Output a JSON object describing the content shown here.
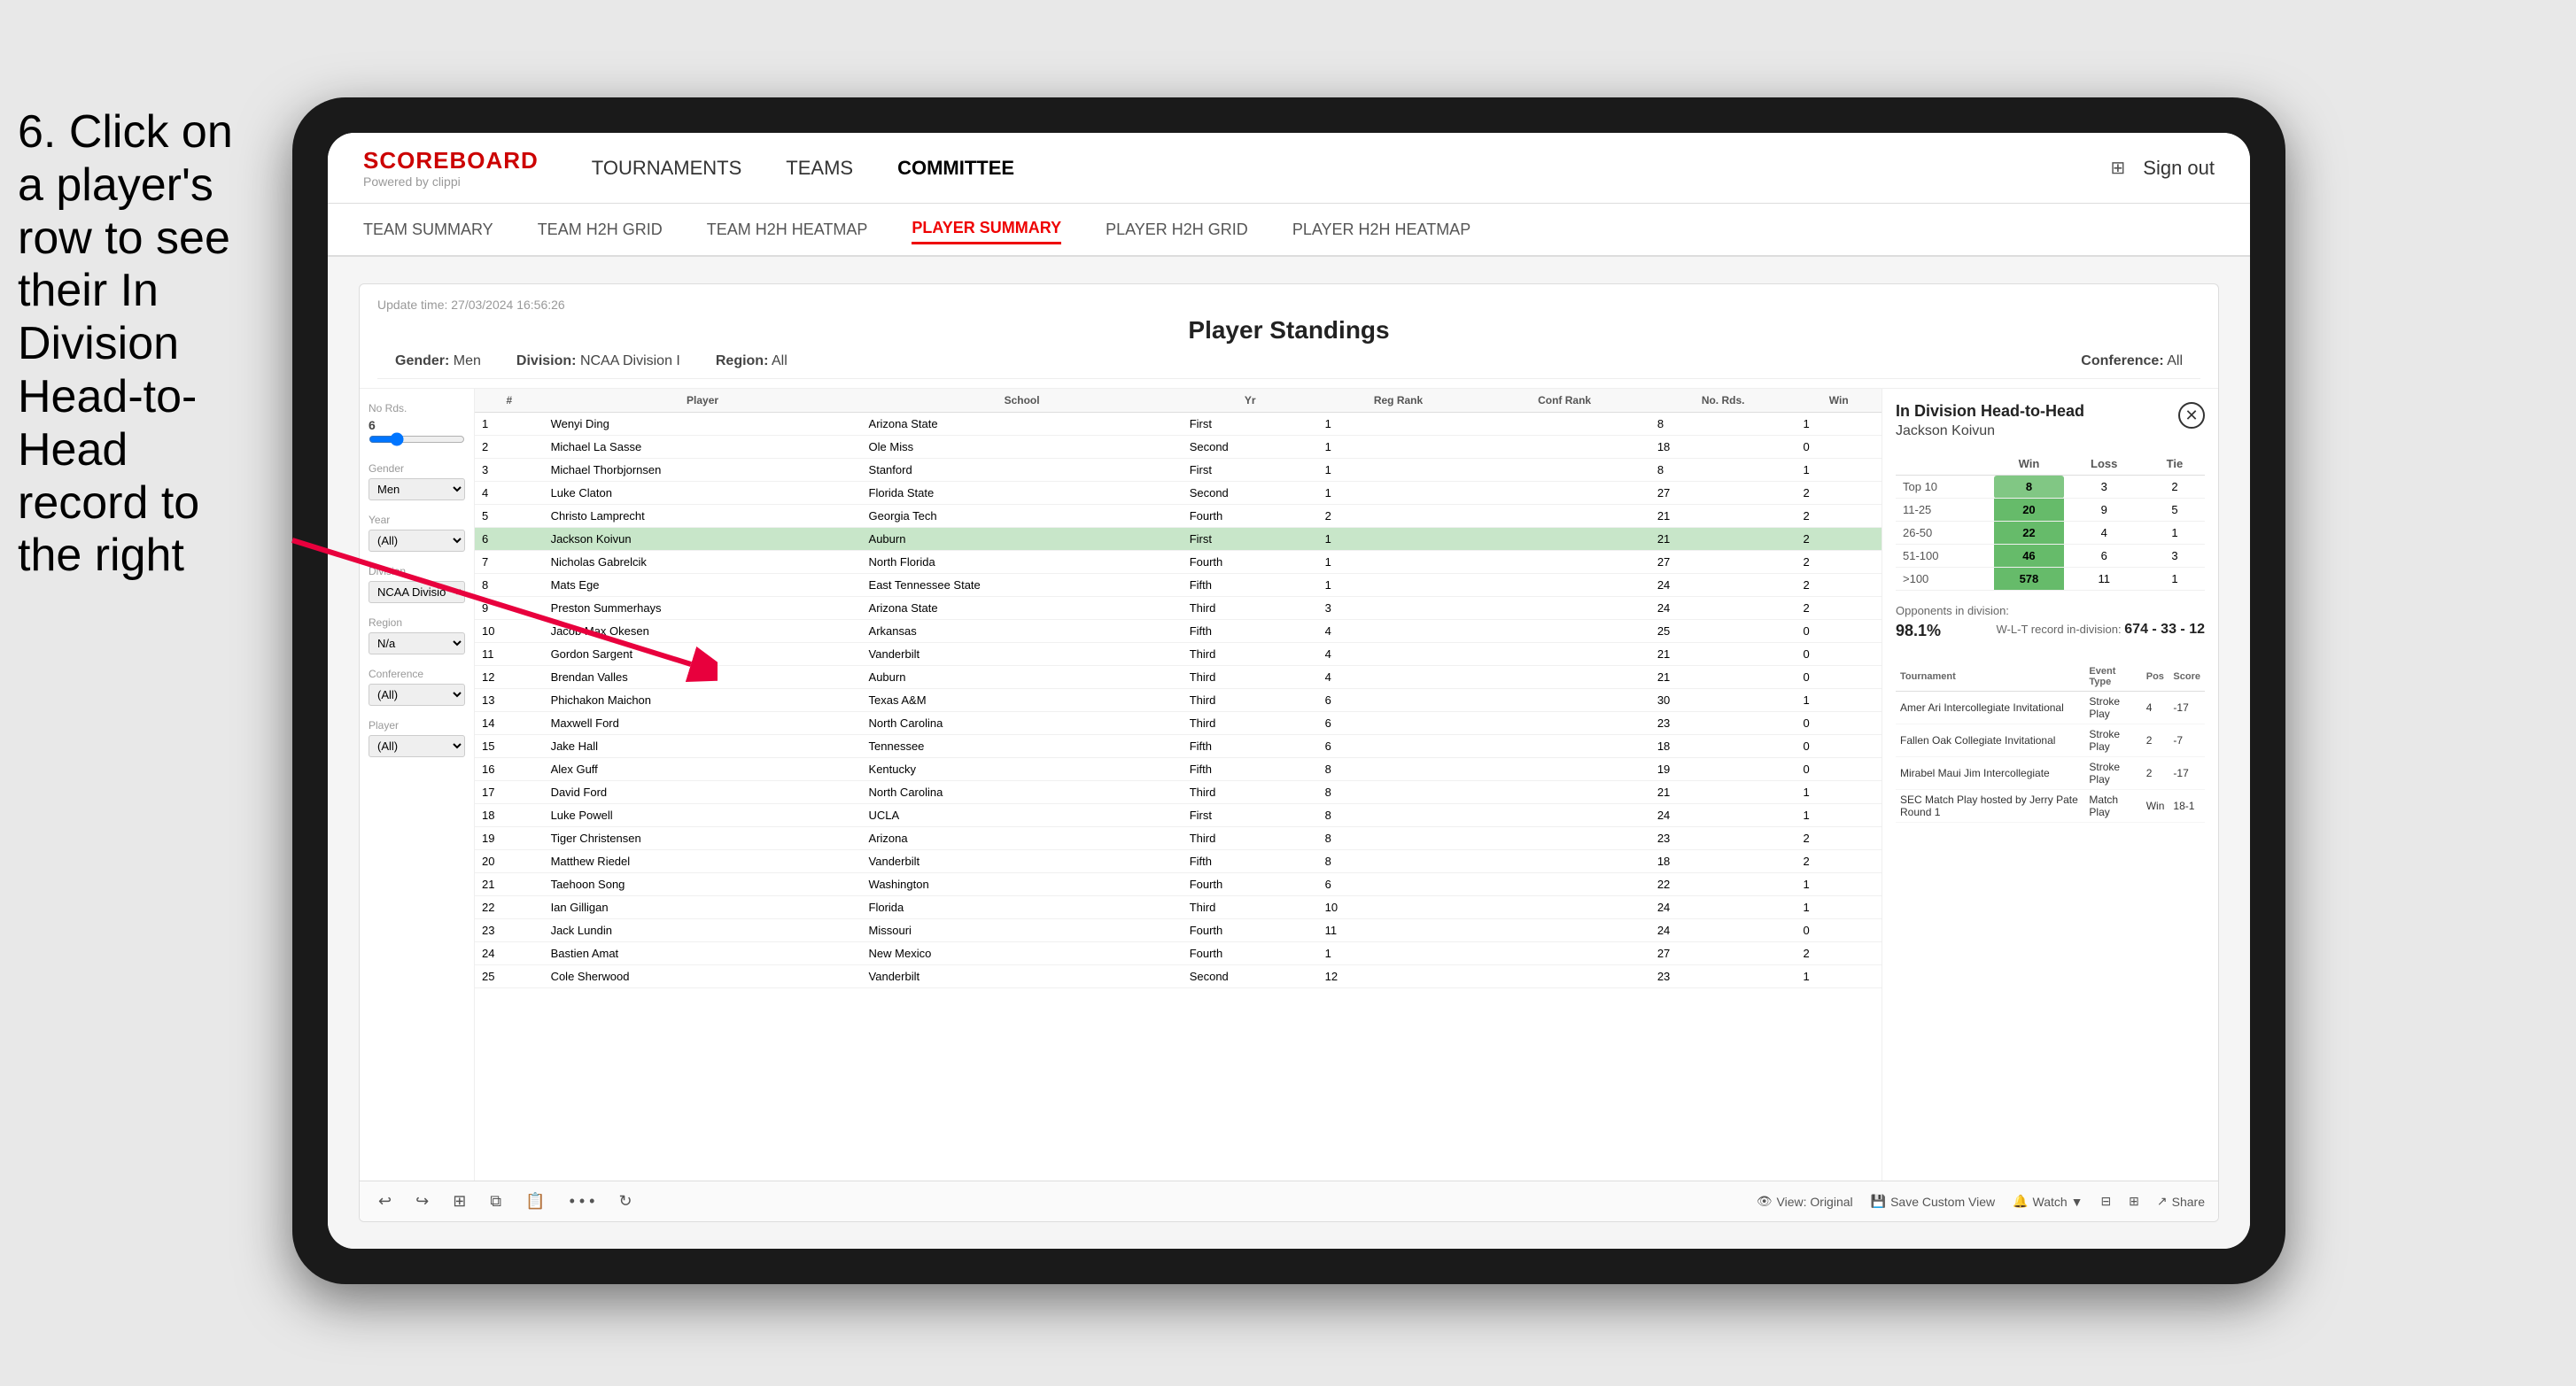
{
  "instruction": {
    "text": "6. Click on a player's row to see their In Division Head-to-Head record to the right"
  },
  "nav": {
    "logo_title": "SCOREBOARD",
    "logo_subtitle": "Powered by clippi",
    "items": [
      {
        "label": "TOURNAMENTS",
        "active": false
      },
      {
        "label": "TEAMS",
        "active": false
      },
      {
        "label": "COMMITTEE",
        "active": true
      }
    ],
    "sign_out": "Sign out"
  },
  "sub_nav": {
    "items": [
      {
        "label": "TEAM SUMMARY",
        "active": false
      },
      {
        "label": "TEAM H2H GRID",
        "active": false
      },
      {
        "label": "TEAM H2H HEATMAP",
        "active": false
      },
      {
        "label": "PLAYER SUMMARY",
        "active": true
      },
      {
        "label": "PLAYER H2H GRID",
        "active": false
      },
      {
        "label": "PLAYER H2H HEATMAP",
        "active": false
      }
    ]
  },
  "panel": {
    "update_time": "Update time: 27/03/2024 16:56:26",
    "title": "Player Standings",
    "filters": {
      "gender_label": "Gender:",
      "gender_value": "Men",
      "division_label": "Division:",
      "division_value": "NCAA Division I",
      "region_label": "Region:",
      "region_value": "All",
      "conference_label": "Conference:",
      "conference_value": "All"
    }
  },
  "sidebar": {
    "rounds_label": "No Rds.",
    "rounds_value": "6",
    "rounds_min": "6",
    "gender_label": "Gender",
    "gender_value": "Men",
    "year_label": "Year",
    "year_value": "(All)",
    "division_label": "Division",
    "division_value": "NCAA Division I",
    "region_label": "Region",
    "region_value": "N/a",
    "conference_label": "Conference",
    "conference_value": "(All)",
    "player_label": "Player",
    "player_value": "(All)"
  },
  "table": {
    "columns": [
      "#",
      "Player",
      "School",
      "Yr",
      "Reg Rank",
      "Conf Rank",
      "No. Rds.",
      "Win"
    ],
    "rows": [
      {
        "num": 1,
        "player": "Wenyi Ding",
        "school": "Arizona State",
        "yr": "First",
        "reg": 1,
        "conf": "",
        "rds": 8,
        "win": 1,
        "highlight": false,
        "selected": false
      },
      {
        "num": 2,
        "player": "Michael La Sasse",
        "school": "Ole Miss",
        "yr": "Second",
        "reg": 1,
        "conf": "",
        "rds": 18,
        "win": 0,
        "highlight": false,
        "selected": false
      },
      {
        "num": 3,
        "player": "Michael Thorbjornsen",
        "school": "Stanford",
        "yr": "First",
        "reg": 1,
        "conf": "",
        "rds": 8,
        "win": 1,
        "highlight": false,
        "selected": false
      },
      {
        "num": 4,
        "player": "Luke Claton",
        "school": "Florida State",
        "yr": "Second",
        "reg": 1,
        "conf": "",
        "rds": 27,
        "win": 2,
        "highlight": false,
        "selected": false
      },
      {
        "num": 5,
        "player": "Christo Lamprecht",
        "school": "Georgia Tech",
        "yr": "Fourth",
        "reg": 2,
        "conf": "",
        "rds": 21,
        "win": 2,
        "highlight": false,
        "selected": false
      },
      {
        "num": 6,
        "player": "Jackson Koivun",
        "school": "Auburn",
        "yr": "First",
        "reg": 1,
        "conf": "",
        "rds": 21,
        "win": 2,
        "highlight": true,
        "selected": false
      },
      {
        "num": 7,
        "player": "Nicholas Gabrelcik",
        "school": "North Florida",
        "yr": "Fourth",
        "reg": 1,
        "conf": "",
        "rds": 27,
        "win": 2,
        "highlight": false,
        "selected": false
      },
      {
        "num": 8,
        "player": "Mats Ege",
        "school": "East Tennessee State",
        "yr": "Fifth",
        "reg": 1,
        "conf": "",
        "rds": 24,
        "win": 2,
        "highlight": false,
        "selected": false
      },
      {
        "num": 9,
        "player": "Preston Summerhays",
        "school": "Arizona State",
        "yr": "Third",
        "reg": 3,
        "conf": "",
        "rds": 24,
        "win": 2,
        "highlight": false,
        "selected": false
      },
      {
        "num": 10,
        "player": "Jacob Max Okesen",
        "school": "Arkansas",
        "yr": "Fifth",
        "reg": 4,
        "conf": "",
        "rds": 25,
        "win": 0,
        "highlight": false,
        "selected": false
      },
      {
        "num": 11,
        "player": "Gordon Sargent",
        "school": "Vanderbilt",
        "yr": "Third",
        "reg": 4,
        "conf": "",
        "rds": 21,
        "win": 0,
        "highlight": false,
        "selected": false
      },
      {
        "num": 12,
        "player": "Brendan Valles",
        "school": "Auburn",
        "yr": "Third",
        "reg": 4,
        "conf": "",
        "rds": 21,
        "win": 0,
        "highlight": false,
        "selected": false
      },
      {
        "num": 13,
        "player": "Phichakon Maichon",
        "school": "Texas A&M",
        "yr": "Third",
        "reg": 6,
        "conf": "",
        "rds": 30,
        "win": 1,
        "highlight": false,
        "selected": false
      },
      {
        "num": 14,
        "player": "Maxwell Ford",
        "school": "North Carolina",
        "yr": "Third",
        "reg": 6,
        "conf": "",
        "rds": 23,
        "win": 0,
        "highlight": false,
        "selected": false
      },
      {
        "num": 15,
        "player": "Jake Hall",
        "school": "Tennessee",
        "yr": "Fifth",
        "reg": 6,
        "conf": "",
        "rds": 18,
        "win": 0,
        "highlight": false,
        "selected": false
      },
      {
        "num": 16,
        "player": "Alex Guff",
        "school": "Kentucky",
        "yr": "Fifth",
        "reg": 8,
        "conf": "",
        "rds": 19,
        "win": 0,
        "highlight": false,
        "selected": false
      },
      {
        "num": 17,
        "player": "David Ford",
        "school": "North Carolina",
        "yr": "Third",
        "reg": 8,
        "conf": "",
        "rds": 21,
        "win": 1,
        "highlight": false,
        "selected": false
      },
      {
        "num": 18,
        "player": "Luke Powell",
        "school": "UCLA",
        "yr": "First",
        "reg": 8,
        "conf": "",
        "rds": 24,
        "win": 1,
        "highlight": false,
        "selected": false
      },
      {
        "num": 19,
        "player": "Tiger Christensen",
        "school": "Arizona",
        "yr": "Third",
        "reg": 8,
        "conf": "",
        "rds": 23,
        "win": 2,
        "highlight": false,
        "selected": false
      },
      {
        "num": 20,
        "player": "Matthew Riedel",
        "school": "Vanderbilt",
        "yr": "Fifth",
        "reg": 8,
        "conf": "",
        "rds": 18,
        "win": 2,
        "highlight": false,
        "selected": false
      },
      {
        "num": 21,
        "player": "Taehoon Song",
        "school": "Washington",
        "yr": "Fourth",
        "reg": 6,
        "conf": "",
        "rds": 22,
        "win": 1,
        "highlight": false,
        "selected": false
      },
      {
        "num": 22,
        "player": "Ian Gilligan",
        "school": "Florida",
        "yr": "Third",
        "reg": 10,
        "conf": "",
        "rds": 24,
        "win": 1,
        "highlight": false,
        "selected": false
      },
      {
        "num": 23,
        "player": "Jack Lundin",
        "school": "Missouri",
        "yr": "Fourth",
        "reg": 11,
        "conf": "",
        "rds": 24,
        "win": 0,
        "highlight": false,
        "selected": false
      },
      {
        "num": 24,
        "player": "Bastien Amat",
        "school": "New Mexico",
        "yr": "Fourth",
        "reg": 1,
        "conf": "",
        "rds": 27,
        "win": 2,
        "highlight": false,
        "selected": false
      },
      {
        "num": 25,
        "player": "Cole Sherwood",
        "school": "Vanderbilt",
        "yr": "Second",
        "reg": 12,
        "conf": "",
        "rds": 23,
        "win": 1,
        "highlight": false,
        "selected": false
      }
    ]
  },
  "h2h": {
    "title": "In Division Head-to-Head",
    "player_name": "Jackson Koivun",
    "close_icon": "✕",
    "table_headers": [
      "",
      "Win",
      "Loss",
      "Tie"
    ],
    "rows": [
      {
        "label": "Top 10",
        "win": 8,
        "loss": 3,
        "tie": 2,
        "win_class": "win-cell"
      },
      {
        "label": "11-25",
        "win": 20,
        "loss": 9,
        "tie": 5,
        "win_class": "win-cell-large"
      },
      {
        "label": "26-50",
        "win": 22,
        "loss": 4,
        "tie": 1,
        "win_class": "win-cell-large"
      },
      {
        "label": "51-100",
        "win": 46,
        "loss": 6,
        "tie": 3,
        "win_class": "win-cell-large"
      },
      {
        "label": ">100",
        "win": 578,
        "loss": 11,
        "tie": 1,
        "win_class": "win-cell-large"
      }
    ],
    "opponents_label": "Opponents in division:",
    "opponents_pct": "98.1%",
    "wlt_label": "W-L-T record in-division:",
    "wlt_value": "674 - 33 - 12",
    "tournament_headers": [
      "Tournament",
      "Event Type",
      "Pos",
      "Score"
    ],
    "tournaments": [
      {
        "name": "Amer Ari Intercollegiate Invitational",
        "type": "Stroke Play",
        "pos": 4,
        "score": "-17"
      },
      {
        "name": "Fallen Oak Collegiate Invitational",
        "type": "Stroke Play",
        "pos": 2,
        "score": "-7"
      },
      {
        "name": "Mirabel Maui Jim Intercollegiate",
        "type": "Stroke Play",
        "pos": 2,
        "score": "-17"
      },
      {
        "name": "SEC Match Play hosted by Jerry Pate Round 1",
        "type": "Match Play",
        "pos": "Win",
        "score": "18-1"
      }
    ]
  },
  "toolbar": {
    "undo": "↩",
    "redo": "↪",
    "view_original": "View: Original",
    "save_custom": "Save Custom View",
    "watch": "Watch ▼",
    "share": "Share"
  }
}
